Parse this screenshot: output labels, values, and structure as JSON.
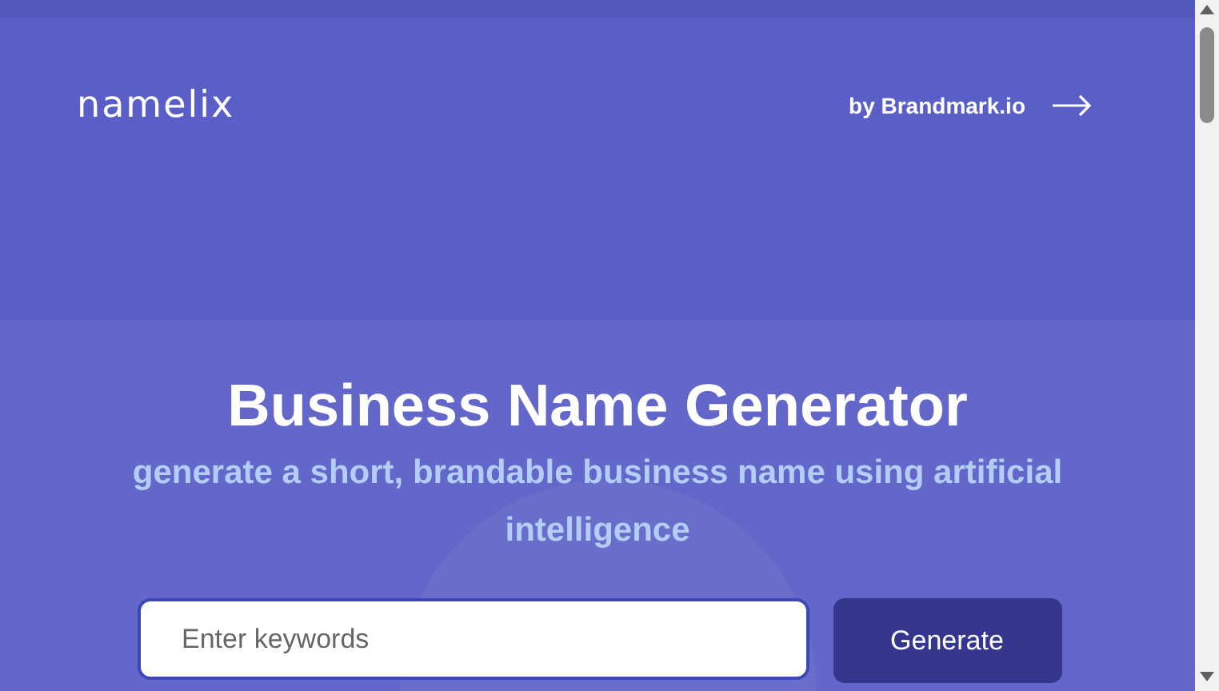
{
  "header": {
    "logo": "namelix",
    "link": "by Brandmark.io"
  },
  "hero": {
    "title": "Business Name Generator",
    "subtitle": "generate a short, brandable business name using artificial intelligence"
  },
  "search": {
    "placeholder": "Enter keywords",
    "button": "Generate"
  }
}
